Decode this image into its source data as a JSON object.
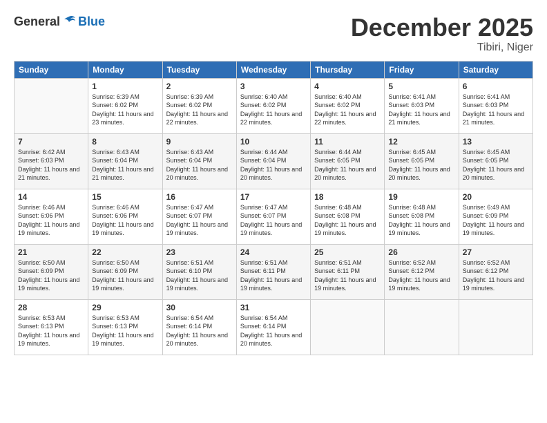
{
  "header": {
    "logo_general": "General",
    "logo_blue": "Blue",
    "month_title": "December 2025",
    "location": "Tibiri, Niger"
  },
  "calendar": {
    "headers": [
      "Sunday",
      "Monday",
      "Tuesday",
      "Wednesday",
      "Thursday",
      "Friday",
      "Saturday"
    ],
    "weeks": [
      [
        {
          "day": "",
          "empty": true
        },
        {
          "day": "1",
          "sunrise": "Sunrise: 6:39 AM",
          "sunset": "Sunset: 6:02 PM",
          "daylight": "Daylight: 11 hours and 23 minutes."
        },
        {
          "day": "2",
          "sunrise": "Sunrise: 6:39 AM",
          "sunset": "Sunset: 6:02 PM",
          "daylight": "Daylight: 11 hours and 22 minutes."
        },
        {
          "day": "3",
          "sunrise": "Sunrise: 6:40 AM",
          "sunset": "Sunset: 6:02 PM",
          "daylight": "Daylight: 11 hours and 22 minutes."
        },
        {
          "day": "4",
          "sunrise": "Sunrise: 6:40 AM",
          "sunset": "Sunset: 6:02 PM",
          "daylight": "Daylight: 11 hours and 22 minutes."
        },
        {
          "day": "5",
          "sunrise": "Sunrise: 6:41 AM",
          "sunset": "Sunset: 6:03 PM",
          "daylight": "Daylight: 11 hours and 21 minutes."
        },
        {
          "day": "6",
          "sunrise": "Sunrise: 6:41 AM",
          "sunset": "Sunset: 6:03 PM",
          "daylight": "Daylight: 11 hours and 21 minutes."
        }
      ],
      [
        {
          "day": "7",
          "sunrise": "Sunrise: 6:42 AM",
          "sunset": "Sunset: 6:03 PM",
          "daylight": "Daylight: 11 hours and 21 minutes."
        },
        {
          "day": "8",
          "sunrise": "Sunrise: 6:43 AM",
          "sunset": "Sunset: 6:04 PM",
          "daylight": "Daylight: 11 hours and 21 minutes."
        },
        {
          "day": "9",
          "sunrise": "Sunrise: 6:43 AM",
          "sunset": "Sunset: 6:04 PM",
          "daylight": "Daylight: 11 hours and 20 minutes."
        },
        {
          "day": "10",
          "sunrise": "Sunrise: 6:44 AM",
          "sunset": "Sunset: 6:04 PM",
          "daylight": "Daylight: 11 hours and 20 minutes."
        },
        {
          "day": "11",
          "sunrise": "Sunrise: 6:44 AM",
          "sunset": "Sunset: 6:05 PM",
          "daylight": "Daylight: 11 hours and 20 minutes."
        },
        {
          "day": "12",
          "sunrise": "Sunrise: 6:45 AM",
          "sunset": "Sunset: 6:05 PM",
          "daylight": "Daylight: 11 hours and 20 minutes."
        },
        {
          "day": "13",
          "sunrise": "Sunrise: 6:45 AM",
          "sunset": "Sunset: 6:05 PM",
          "daylight": "Daylight: 11 hours and 20 minutes."
        }
      ],
      [
        {
          "day": "14",
          "sunrise": "Sunrise: 6:46 AM",
          "sunset": "Sunset: 6:06 PM",
          "daylight": "Daylight: 11 hours and 19 minutes."
        },
        {
          "day": "15",
          "sunrise": "Sunrise: 6:46 AM",
          "sunset": "Sunset: 6:06 PM",
          "daylight": "Daylight: 11 hours and 19 minutes."
        },
        {
          "day": "16",
          "sunrise": "Sunrise: 6:47 AM",
          "sunset": "Sunset: 6:07 PM",
          "daylight": "Daylight: 11 hours and 19 minutes."
        },
        {
          "day": "17",
          "sunrise": "Sunrise: 6:47 AM",
          "sunset": "Sunset: 6:07 PM",
          "daylight": "Daylight: 11 hours and 19 minutes."
        },
        {
          "day": "18",
          "sunrise": "Sunrise: 6:48 AM",
          "sunset": "Sunset: 6:08 PM",
          "daylight": "Daylight: 11 hours and 19 minutes."
        },
        {
          "day": "19",
          "sunrise": "Sunrise: 6:48 AM",
          "sunset": "Sunset: 6:08 PM",
          "daylight": "Daylight: 11 hours and 19 minutes."
        },
        {
          "day": "20",
          "sunrise": "Sunrise: 6:49 AM",
          "sunset": "Sunset: 6:09 PM",
          "daylight": "Daylight: 11 hours and 19 minutes."
        }
      ],
      [
        {
          "day": "21",
          "sunrise": "Sunrise: 6:50 AM",
          "sunset": "Sunset: 6:09 PM",
          "daylight": "Daylight: 11 hours and 19 minutes."
        },
        {
          "day": "22",
          "sunrise": "Sunrise: 6:50 AM",
          "sunset": "Sunset: 6:09 PM",
          "daylight": "Daylight: 11 hours and 19 minutes."
        },
        {
          "day": "23",
          "sunrise": "Sunrise: 6:51 AM",
          "sunset": "Sunset: 6:10 PM",
          "daylight": "Daylight: 11 hours and 19 minutes."
        },
        {
          "day": "24",
          "sunrise": "Sunrise: 6:51 AM",
          "sunset": "Sunset: 6:11 PM",
          "daylight": "Daylight: 11 hours and 19 minutes."
        },
        {
          "day": "25",
          "sunrise": "Sunrise: 6:51 AM",
          "sunset": "Sunset: 6:11 PM",
          "daylight": "Daylight: 11 hours and 19 minutes."
        },
        {
          "day": "26",
          "sunrise": "Sunrise: 6:52 AM",
          "sunset": "Sunset: 6:12 PM",
          "daylight": "Daylight: 11 hours and 19 minutes."
        },
        {
          "day": "27",
          "sunrise": "Sunrise: 6:52 AM",
          "sunset": "Sunset: 6:12 PM",
          "daylight": "Daylight: 11 hours and 19 minutes."
        }
      ],
      [
        {
          "day": "28",
          "sunrise": "Sunrise: 6:53 AM",
          "sunset": "Sunset: 6:13 PM",
          "daylight": "Daylight: 11 hours and 19 minutes."
        },
        {
          "day": "29",
          "sunrise": "Sunrise: 6:53 AM",
          "sunset": "Sunset: 6:13 PM",
          "daylight": "Daylight: 11 hours and 19 minutes."
        },
        {
          "day": "30",
          "sunrise": "Sunrise: 6:54 AM",
          "sunset": "Sunset: 6:14 PM",
          "daylight": "Daylight: 11 hours and 20 minutes."
        },
        {
          "day": "31",
          "sunrise": "Sunrise: 6:54 AM",
          "sunset": "Sunset: 6:14 PM",
          "daylight": "Daylight: 11 hours and 20 minutes."
        },
        {
          "day": "",
          "empty": true
        },
        {
          "day": "",
          "empty": true
        },
        {
          "day": "",
          "empty": true
        }
      ]
    ]
  }
}
